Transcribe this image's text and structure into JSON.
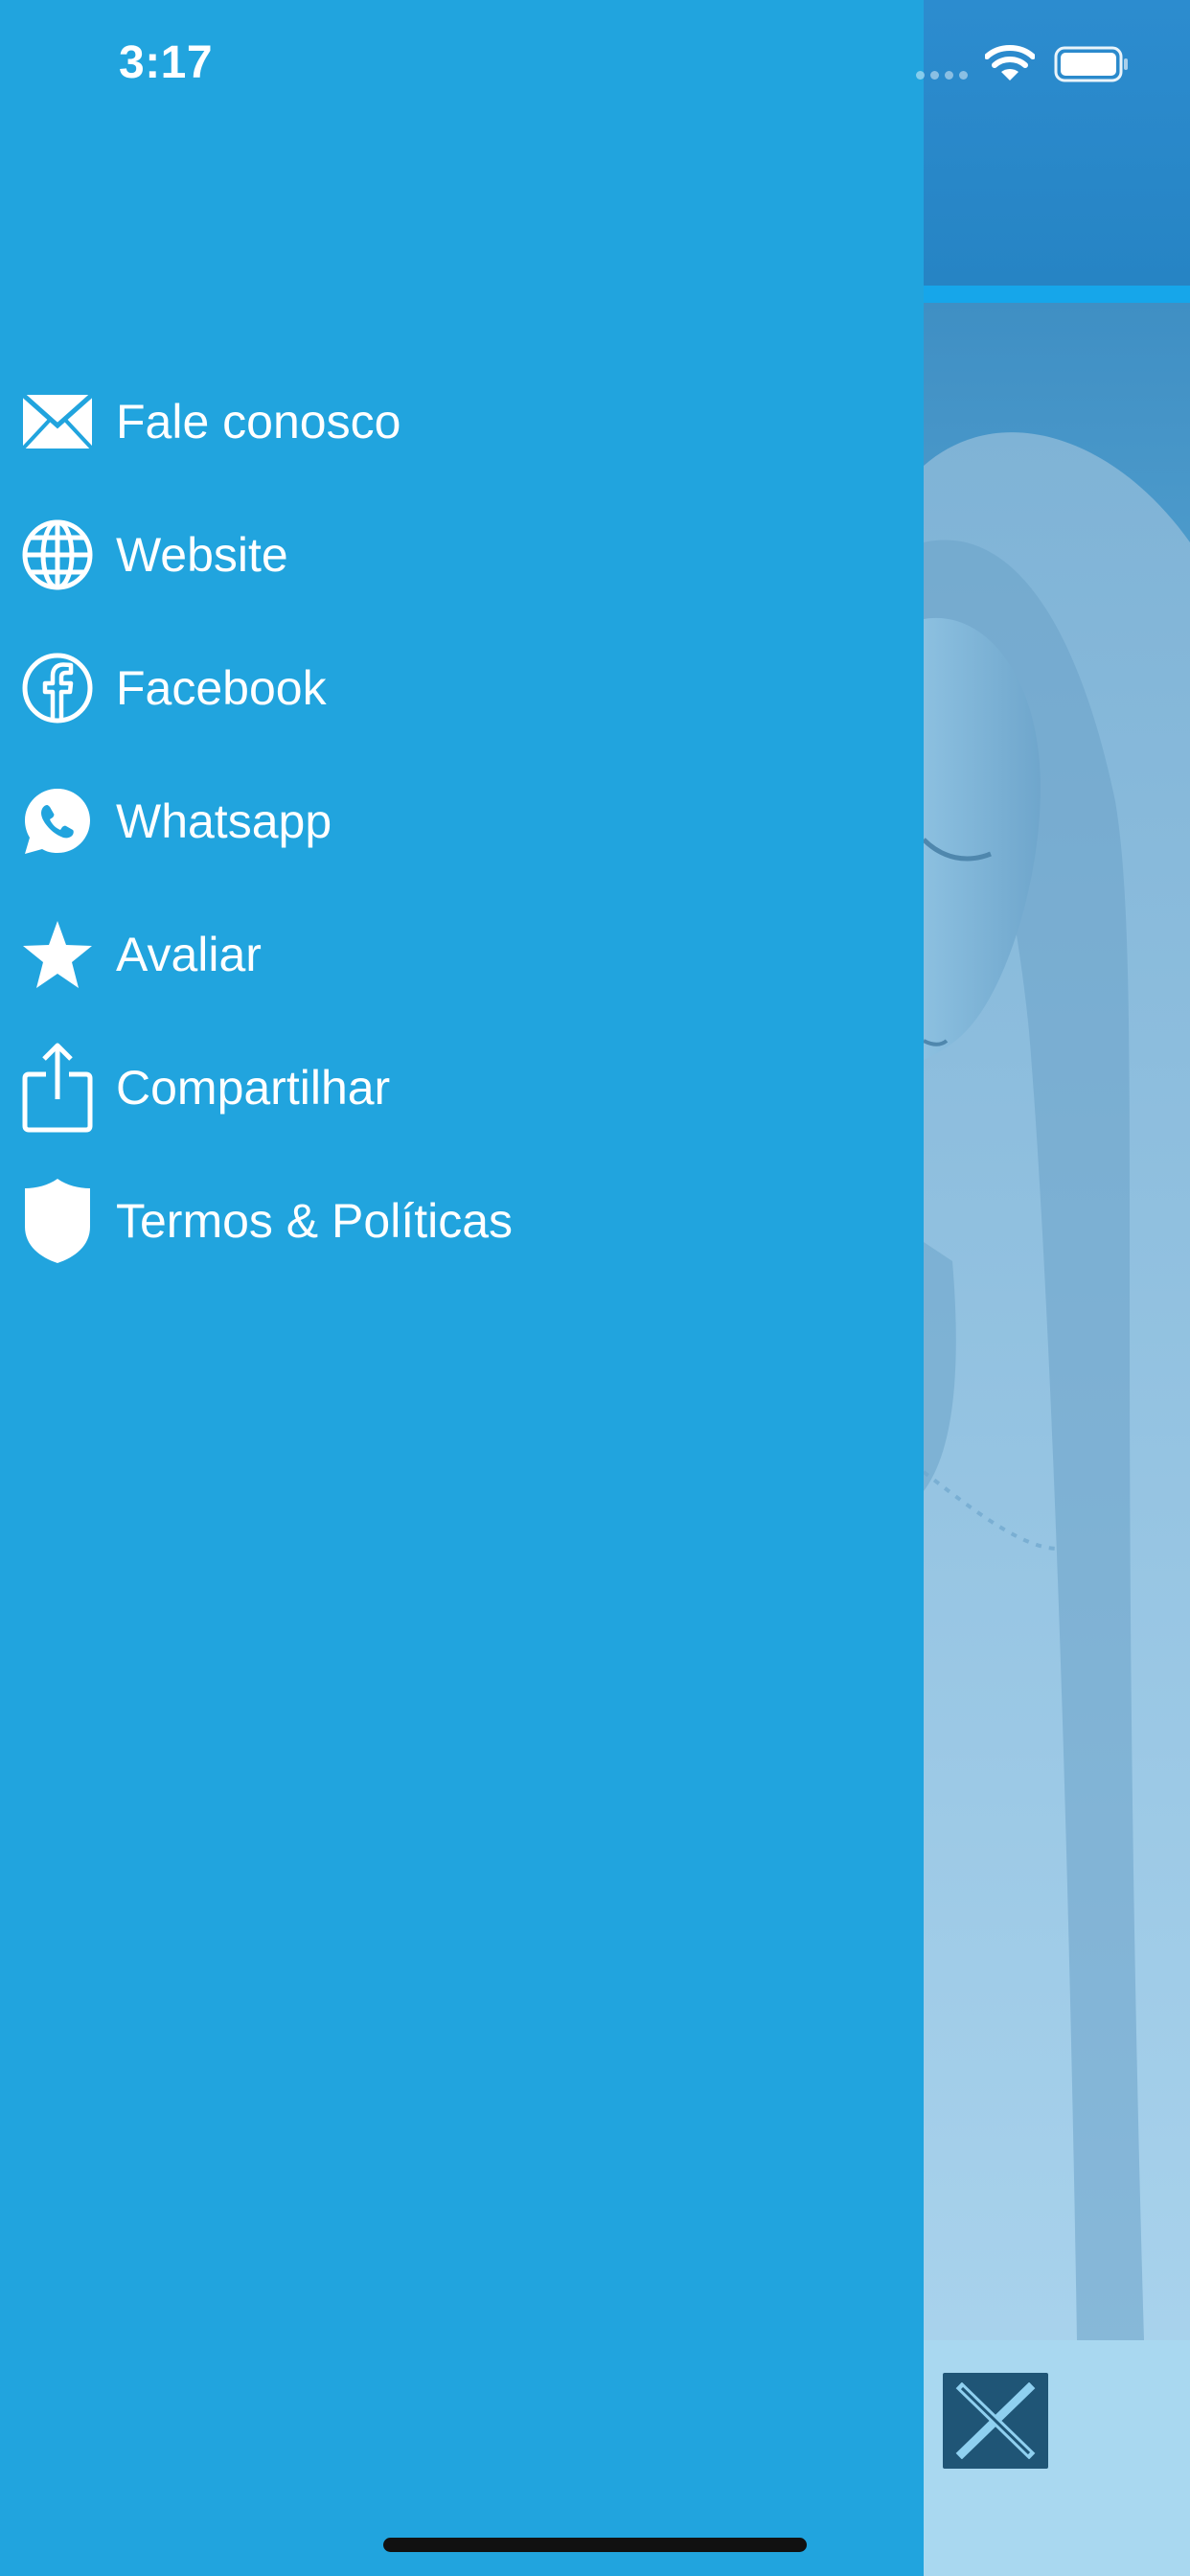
{
  "status_bar": {
    "time": "3:17",
    "wifi_icon": "wifi-icon",
    "battery_icon": "battery-icon"
  },
  "drawer": {
    "background": "#21a4de",
    "text_color": "#ffffff",
    "menu": [
      {
        "label": "Fale conosco",
        "icon": "mail-icon"
      },
      {
        "label": "Website",
        "icon": "globe-icon"
      },
      {
        "label": "Facebook",
        "icon": "facebook-icon"
      },
      {
        "label": "Whatsapp",
        "icon": "whatsapp-icon"
      },
      {
        "label": "Avaliar",
        "icon": "star-icon"
      },
      {
        "label": "Compartilhar",
        "icon": "share-icon"
      },
      {
        "label": "Termos & Políticas",
        "icon": "shield-icon"
      }
    ]
  },
  "background_app": {
    "header_color": "#2a86c8",
    "accent_line_color": "#16a6ea",
    "bottom_bar_color": "#a9d8f0",
    "close_icon": "x-close-icon"
  }
}
